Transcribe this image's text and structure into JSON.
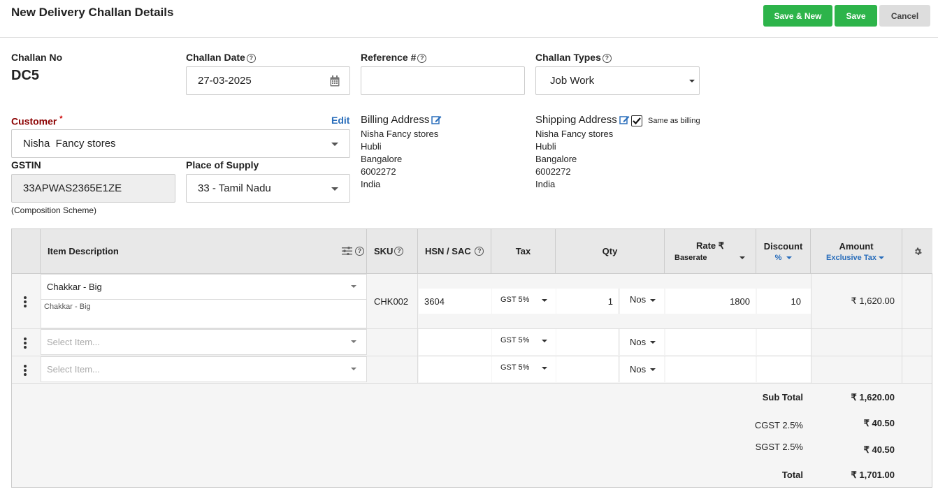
{
  "header": {
    "title": "New Delivery Challan Details",
    "save_new": "Save & New",
    "save": "Save",
    "cancel": "Cancel"
  },
  "challan_no": {
    "label": "Challan No",
    "value": "DC5"
  },
  "challan_date": {
    "label": "Challan Date",
    "value": "27-03-2025"
  },
  "reference": {
    "label": "Reference #",
    "value": ""
  },
  "challan_types": {
    "label": "Challan Types",
    "value": "Job Work"
  },
  "customer": {
    "label": "Customer",
    "required": "*",
    "edit": "Edit",
    "value": "Nisha  Fancy stores"
  },
  "gstin": {
    "label": "GSTIN",
    "value": "33APWAS2365E1ZE",
    "note": "(Composition Scheme)"
  },
  "place_of_supply": {
    "label": "Place of Supply",
    "value": "33 - Tamil Nadu"
  },
  "billing": {
    "title": "Billing Address",
    "lines": [
      "Nisha Fancy stores",
      "Hubli",
      "Bangalore",
      "6002272",
      "India"
    ]
  },
  "shipping": {
    "title": "Shipping Address",
    "same_label": "Same as billing",
    "lines": [
      "Nisha Fancy stores",
      "Hubli",
      "Bangalore",
      "6002272",
      "India"
    ]
  },
  "table": {
    "headers": {
      "item": "Item Description",
      "sku": "SKU",
      "hsn": "HSN / SAC",
      "tax": "Tax",
      "qty": "Qty",
      "rate": "Rate ₹",
      "rate_sub": "Baserate",
      "discount": "Discount",
      "discount_sub": "%",
      "amount": "Amount",
      "amount_sub": "Exclusive Tax"
    },
    "rows": [
      {
        "item": "Chakkar - Big",
        "desc": "Chakkar - Big",
        "sku": "CHK002",
        "hsn": "3604",
        "tax": "GST 5%",
        "qty": "1",
        "unit": "Nos",
        "rate": "1800",
        "discount": "10",
        "amount": "₹ 1,620.00"
      },
      {
        "item_placeholder": "Select Item...",
        "tax": "GST 5%",
        "unit": "Nos"
      },
      {
        "item_placeholder": "Select Item...",
        "tax": "GST 5%",
        "unit": "Nos"
      }
    ]
  },
  "totals": {
    "sub_total_label": "Sub Total",
    "sub_total": "₹ 1,620.00",
    "cgst_label": "CGST 2.5%",
    "cgst": "₹ 40.50",
    "sgst_label": "SGST 2.5%",
    "sgst": "₹ 40.50",
    "total_label": "Total",
    "total": "₹ 1,701.00"
  },
  "colors": {
    "green": "#2db44a",
    "accent_blue": "#2a6ebb",
    "required_red": "#8b0000"
  }
}
